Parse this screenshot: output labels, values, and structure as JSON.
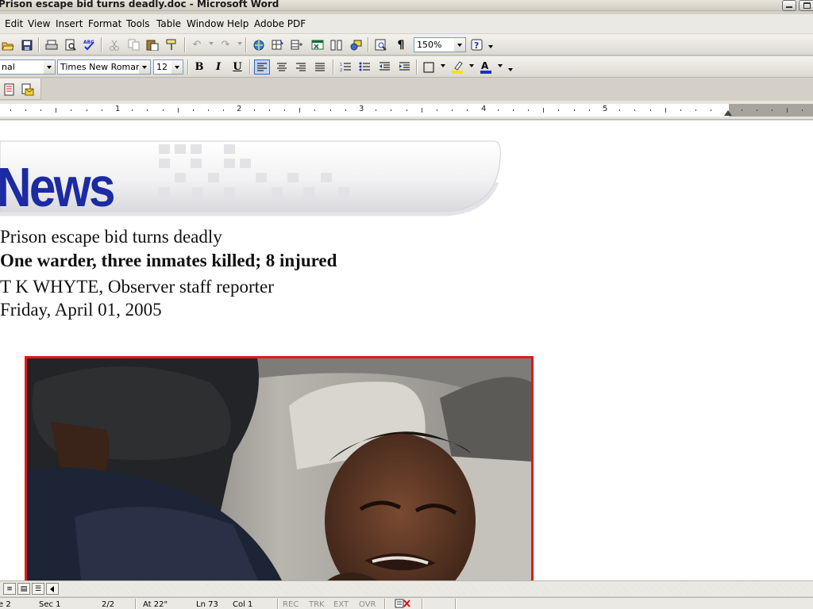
{
  "window": {
    "title": "Prison escape bid turns deadly.doc - Microsoft Word"
  },
  "menu": {
    "items": [
      "Edit",
      "View",
      "Insert",
      "Format",
      "Tools",
      "Table",
      "Window",
      "Help",
      "Adobe PDF"
    ]
  },
  "standard_toolbar": {
    "zoom": "150%"
  },
  "formatting_toolbar": {
    "style": "nal",
    "font": "Times New Roman",
    "size": "12",
    "bold": "B",
    "italic": "I",
    "underline": "U"
  },
  "ruler": {
    "labels": [
      "1",
      "2",
      "3",
      "4",
      "5"
    ]
  },
  "document": {
    "banner": "News",
    "headline": "Prison escape bid turns deadly",
    "subheadline": "One warder, three inmates killed; 8 injured",
    "byline": "T K WHYTE, Observer staff reporter",
    "date": "Friday, April 01, 2005"
  },
  "status": {
    "page": "e 2",
    "section": "Sec 1",
    "pages": "2/2",
    "at": "At 22\"",
    "line": "Ln 73",
    "col": "Col 1",
    "rec": "REC",
    "trk": "TRK",
    "ext": "EXT",
    "ovr": "OVR"
  },
  "icons": [
    "open-icon",
    "save-icon",
    "print-icon",
    "print-preview-icon",
    "spelling-icon",
    "cut-icon",
    "copy-icon",
    "paste-icon",
    "format-painter-icon",
    "undo-icon",
    "redo-icon",
    "hyperlink-icon",
    "tables-borders-icon",
    "insert-table-icon",
    "insert-excel-icon",
    "columns-icon",
    "drawing-icon",
    "document-map-icon",
    "show-hide-icon",
    "help-icon",
    "align-left-icon",
    "center-icon",
    "align-right-icon",
    "justify-icon",
    "numbering-icon",
    "bullets-icon",
    "decrease-indent-icon",
    "increase-indent-icon",
    "borders-icon",
    "highlight-icon",
    "font-color-icon",
    "convert-to-pdf-icon",
    "convert-and-email-icon",
    "spell-check-status-icon"
  ],
  "colors": {
    "banner_text": "#1c2aa3",
    "photo_border": "#e11a1a",
    "font_color_bar": "#1d2fd1",
    "highlight_bar": "#f2e600"
  }
}
